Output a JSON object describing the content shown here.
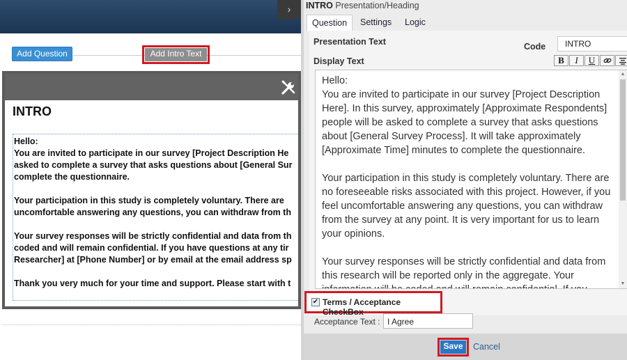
{
  "left": {
    "collapse_glyph": "›",
    "add_question_label": "Add Question",
    "add_intro_label": "Add Intro Text",
    "card": {
      "tools_icon": "wrench-screwdriver-icon",
      "title": "INTRO",
      "text_lines": "Hello:\nYou are invited to participate in our survey [Project Description He\nasked to complete a survey that asks questions about [General Sur\ncomplete the questionnaire.\n\nYour participation in this study is completely voluntary. There are \nuncomfortable answering any questions, you can withdraw from th\n\nYour survey responses will be strictly confidential and data from th\ncoded and will remain confidential. If you have questions at any tir\nResearcher] at [Phone Number] or by email at the email address sp\n\nThank you very much for your time and support. Please start with t"
    }
  },
  "panel": {
    "title_code": "INTRO",
    "title_type": "Presentation/Heading",
    "tabs": [
      "Question",
      "Settings",
      "Logic"
    ],
    "presentation_text_label": "Presentation Text",
    "code_label": "Code",
    "code_value": "INTRO",
    "display_text_label": "Display Text",
    "format_buttons": [
      {
        "label": "B",
        "icon": "bold-icon"
      },
      {
        "label": "I",
        "icon": "italic-icon"
      },
      {
        "label": "U",
        "icon": "underline-icon"
      },
      {
        "label": "",
        "icon": "link-icon"
      },
      {
        "label": "",
        "icon": "align-center-icon"
      }
    ],
    "display_text": "Hello:\nYou are invited to participate in our survey [Project Description\nHere]. In this survey, approximately [Approximate Respondents]\npeople will be asked to complete a survey that asks questions\nabout [General Survey Process]. It will take approximately\n[Approximate Time] minutes to complete the questionnaire.\n\nYour participation in this study is completely voluntary. There are\nno foreseeable risks associated with this project. However, if you\nfeel uncomfortable answering any questions, you can withdraw\nfrom the survey at any point. It is very important for us to learn\nyour opinions.\n\nYour survey responses will be strictly confidential and data from\nthis research will be reported only in the aggregate. Your\ninformation will be coded and will remain confidential. If you",
    "terms_checked": true,
    "terms_label": "Terms / Acceptance CheckBox",
    "acceptance_label": "Acceptance Text :",
    "acceptance_value": "I Agree",
    "save_label": "Save",
    "cancel_label": "Cancel"
  },
  "colors": {
    "highlight": "#d01a24",
    "primary_button": "#3a8fd4",
    "save_button": "#2a77c4",
    "header_dark": "#1b3453"
  }
}
